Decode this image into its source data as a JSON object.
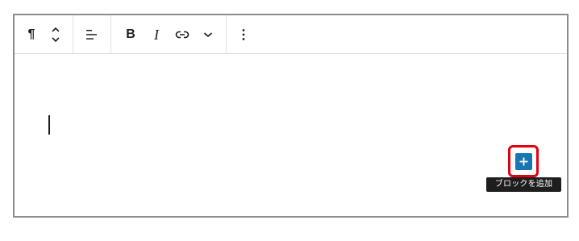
{
  "toolbar": {
    "paragraph_glyph": "¶",
    "bold_label": "B",
    "italic_label": "I",
    "icons": {
      "paragraph": "pilcrow-icon",
      "move": "move-up-down-icon",
      "align": "align-left-icon",
      "link": "link-icon",
      "more_rich": "chevron-down-icon",
      "options": "more-vertical-icon"
    }
  },
  "editor": {
    "add_block_icon": "plus-icon",
    "add_block_tooltip": "ブロックを追加"
  },
  "colors": {
    "accent": "#1976b5",
    "highlight": "#e0000f",
    "tooltip_bg": "#1e1e1e",
    "border": "#8c8c8c"
  }
}
